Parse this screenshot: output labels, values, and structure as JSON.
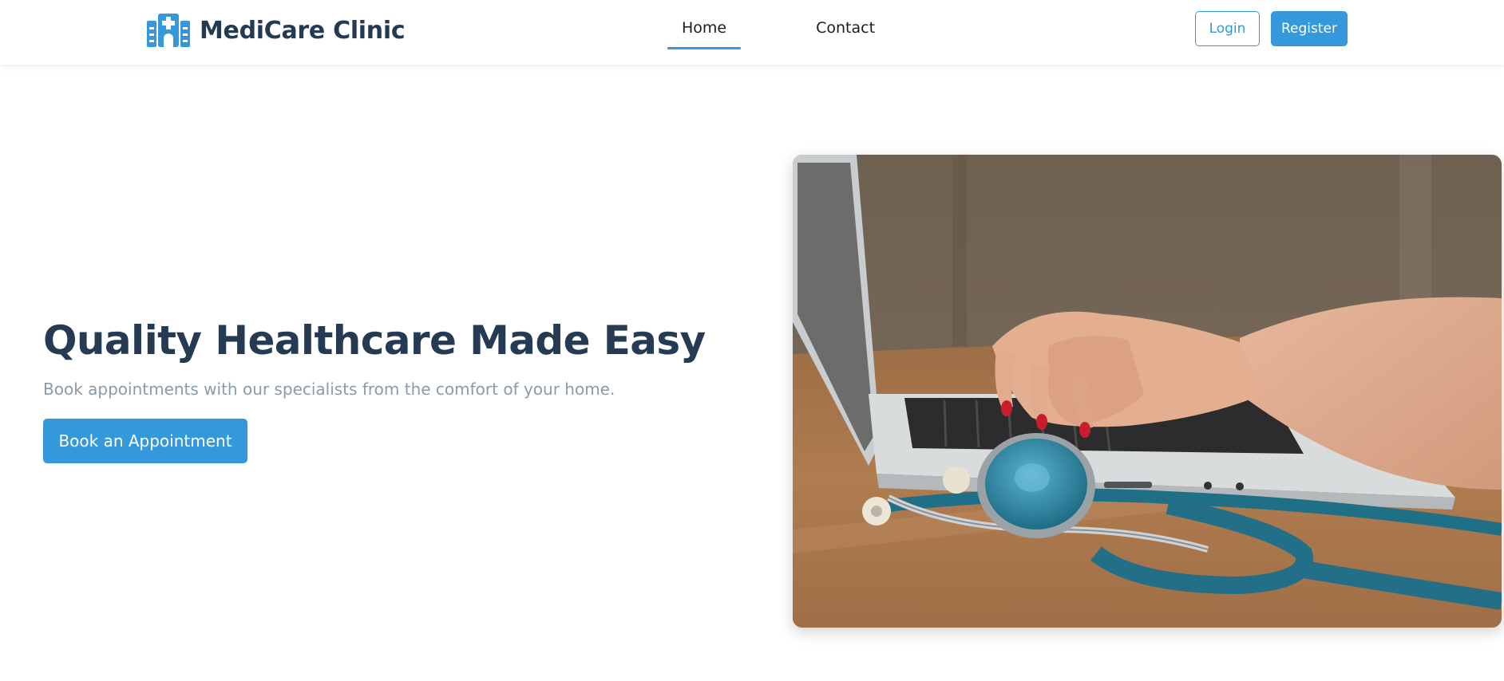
{
  "brand": {
    "name": "MediCare Clinic",
    "icon": "hospital-building-icon",
    "color": "#3498db"
  },
  "nav": {
    "links": [
      {
        "label": "Home",
        "active": true
      },
      {
        "label": "Contact",
        "active": false
      }
    ]
  },
  "auth": {
    "login_label": "Login",
    "register_label": "Register"
  },
  "hero": {
    "title": "Quality Healthcare Made Easy",
    "subtitle": "Book appointments with our specialists from the comfort of your home.",
    "cta_label": "Book an Appointment",
    "image": "photo-hands-typing-laptop-with-stethoscope"
  },
  "colors": {
    "accent": "#3498db",
    "heading": "#243b53",
    "muted": "#8a9ba8"
  }
}
